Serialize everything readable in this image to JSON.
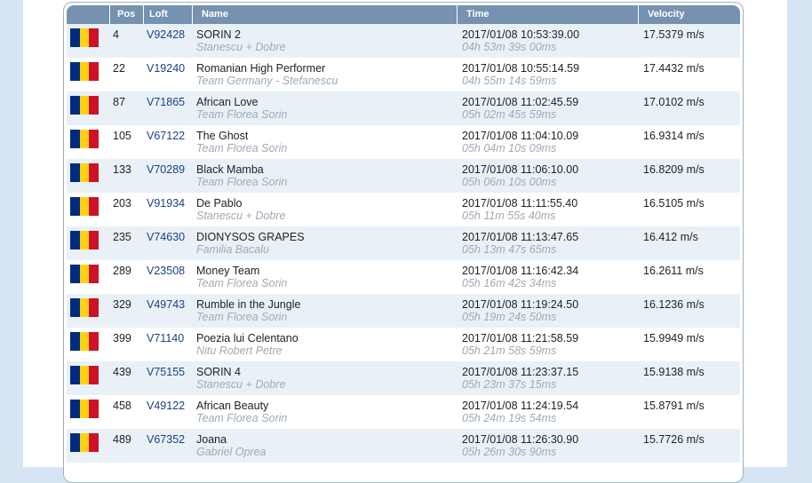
{
  "colors": {
    "flag_blue": "#002b7f",
    "flag_yellow": "#fcd116",
    "flag_red": "#ce1126",
    "header_bg": "#7692b1",
    "row_alt_bg": "#e9f1f7",
    "loft_text": "#1c3f86",
    "subtext": "#a1a9b3"
  },
  "table": {
    "headers": {
      "flag": "",
      "pos": "Pos",
      "loft": "Loft",
      "name": "Name",
      "time": "Time",
      "velocity": "Velocity"
    },
    "rows": [
      {
        "flag": "romania-flag-icon",
        "pos": "4",
        "loft": "V92428",
        "name": "SORIN 2",
        "team": "Stanescu + Dobre",
        "time": "2017/01/08 10:53:39.00",
        "duration": "04h 53m 39s 00ms",
        "velocity": "17.5379 m/s"
      },
      {
        "flag": "romania-flag-icon",
        "pos": "22",
        "loft": "V19240",
        "name": "Romanian High Performer",
        "team": "Team Germany - Stefanescu",
        "time": "2017/01/08 10:55:14.59",
        "duration": "04h 55m 14s 59ms",
        "velocity": "17.4432 m/s"
      },
      {
        "flag": "romania-flag-icon",
        "pos": "87",
        "loft": "V71865",
        "name": "African Love",
        "team": "Team Florea Sorin",
        "time": "2017/01/08 11:02:45.59",
        "duration": "05h 02m 45s 59ms",
        "velocity": "17.0102 m/s"
      },
      {
        "flag": "romania-flag-icon",
        "pos": "105",
        "loft": "V67122",
        "name": "The Ghost",
        "team": "Team Florea Sorin",
        "time": "2017/01/08 11:04:10.09",
        "duration": "05h 04m 10s 09ms",
        "velocity": "16.9314 m/s"
      },
      {
        "flag": "romania-flag-icon",
        "pos": "133",
        "loft": "V70289",
        "name": "Black Mamba",
        "team": "Team Florea Sorin",
        "time": "2017/01/08 11:06:10.00",
        "duration": "05h 06m 10s 00ms",
        "velocity": "16.8209 m/s"
      },
      {
        "flag": "romania-flag-icon",
        "pos": "203",
        "loft": "V91934",
        "name": "De Pablo",
        "team": "Stanescu + Dobre",
        "time": "2017/01/08 11:11:55.40",
        "duration": "05h 11m 55s 40ms",
        "velocity": "16.5105 m/s"
      },
      {
        "flag": "romania-flag-icon",
        "pos": "235",
        "loft": "V74630",
        "name": "DIONYSOS GRAPES",
        "team": "Familia Bacalu",
        "time": "2017/01/08 11:13:47.65",
        "duration": "05h 13m 47s 65ms",
        "velocity": "16.412 m/s"
      },
      {
        "flag": "romania-flag-icon",
        "pos": "289",
        "loft": "V23508",
        "name": "Money Team",
        "team": "Team Florea Sorin",
        "time": "2017/01/08 11:16:42.34",
        "duration": "05h 16m 42s 34ms",
        "velocity": "16.2611 m/s"
      },
      {
        "flag": "romania-flag-icon",
        "pos": "329",
        "loft": "V49743",
        "name": "Rumble in the Jungle",
        "team": "Team Florea Sorin",
        "time": "2017/01/08 11:19:24.50",
        "duration": "05h 19m 24s 50ms",
        "velocity": "16.1236 m/s"
      },
      {
        "flag": "romania-flag-icon",
        "pos": "399",
        "loft": "V71140",
        "name": "Poezia lui Celentano",
        "team": "Nitu Robert Petre",
        "time": "2017/01/08 11:21:58.59",
        "duration": "05h 21m 58s 59ms",
        "velocity": "15.9949 m/s"
      },
      {
        "flag": "romania-flag-icon",
        "pos": "439",
        "loft": "V75155",
        "name": "SORIN 4",
        "team": "Stanescu + Dobre",
        "time": "2017/01/08 11:23:37.15",
        "duration": "05h 23m 37s 15ms",
        "velocity": "15.9138 m/s"
      },
      {
        "flag": "romania-flag-icon",
        "pos": "458",
        "loft": "V49122",
        "name": "African Beauty",
        "team": "Team Florea Sorin",
        "time": "2017/01/08 11:24:19.54",
        "duration": "05h 24m 19s 54ms",
        "velocity": "15.8791 m/s"
      },
      {
        "flag": "romania-flag-icon",
        "pos": "489",
        "loft": "V67352",
        "name": "Joana",
        "team": "Gabriel Oprea",
        "time": "2017/01/08 11:26:30.90",
        "duration": "05h 26m 30s 90ms",
        "velocity": "15.7726 m/s"
      }
    ]
  }
}
